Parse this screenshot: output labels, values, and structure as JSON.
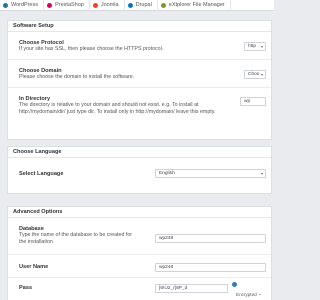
{
  "app_tabs": [
    {
      "label": "WordPress",
      "icon": "wordpress-icon",
      "color": "#21759b"
    },
    {
      "label": "PrestaShop",
      "icon": "prestashop-icon",
      "color": "#df0067"
    },
    {
      "label": "Joomla",
      "icon": "joomla-icon",
      "color": "#f44321"
    },
    {
      "label": "Drupal",
      "icon": "drupal-icon",
      "color": "#0678be"
    },
    {
      "label": "eXtplorer File Manager",
      "icon": "extplorer-icon",
      "color": "#7a9a2a"
    }
  ],
  "software_setup": {
    "title": "Software Setup",
    "protocol": {
      "label": "Choose Protocol",
      "desc": "If your site has SSL, then please choose the HTTPS protocol.",
      "value": "http"
    },
    "domain": {
      "label": "Choose Domain",
      "desc": "Please choose the domain to install the software.",
      "value": "Choo"
    },
    "directory": {
      "label": "In Directory",
      "desc": "The directory is relative to your domain and should not exist. e.g. To install at http://mydomain/dir/ just type dir. To install only in http://mydomain/ leave this empty.",
      "value": "wp"
    }
  },
  "choose_language": {
    "title": "Choose Language",
    "select": {
      "label": "Select Language",
      "value": "English"
    }
  },
  "advanced_options": {
    "title": "Advanced Options",
    "database": {
      "label": "Database",
      "desc": "Type the name of the database to be created for the installation",
      "value": "wp248"
    },
    "username": {
      "label": "User Name",
      "value": "wp248"
    },
    "pass": {
      "label": "Pass",
      "value": "[6!U2_r]8P_d",
      "encryption": "Encrypted"
    }
  }
}
